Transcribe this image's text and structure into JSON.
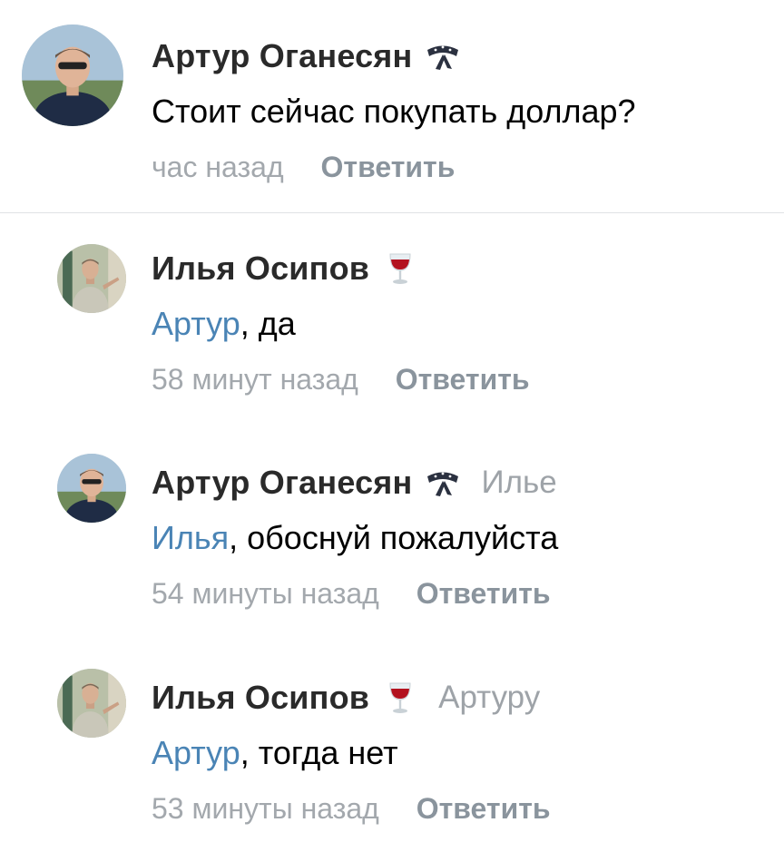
{
  "comments": [
    {
      "author": "Артур Оганесян",
      "badge_icon": "bandana-icon",
      "reply_to": "",
      "mention": "",
      "separator": "",
      "text": "Стоит сейчас покупать доллар?",
      "time": "час назад",
      "reply_label": "Ответить"
    },
    {
      "author": "Илья Осипов",
      "badge_icon": "wine-glass-icon",
      "reply_to": "",
      "mention": "Артур",
      "separator": ", ",
      "text": "да",
      "time": "58 минут назад",
      "reply_label": "Ответить"
    },
    {
      "author": "Артур Оганесян",
      "badge_icon": "bandana-icon",
      "reply_to": "Илье",
      "mention": "Илья",
      "separator": ", ",
      "text": "обоснуй пожалуйста",
      "time": "54 минуты назад",
      "reply_label": "Ответить"
    },
    {
      "author": "Илья Осипов",
      "badge_icon": "wine-glass-icon",
      "reply_to": "Артуру",
      "mention": "Артур",
      "separator": ", ",
      "text": "тогда нет",
      "time": "53 минуты назад",
      "reply_label": "Ответить"
    }
  ],
  "colors": {
    "mention": "#4a84b5",
    "meta": "#a3a8ad",
    "reply_button": "#8a949d",
    "separator": "#dfe2e5"
  }
}
